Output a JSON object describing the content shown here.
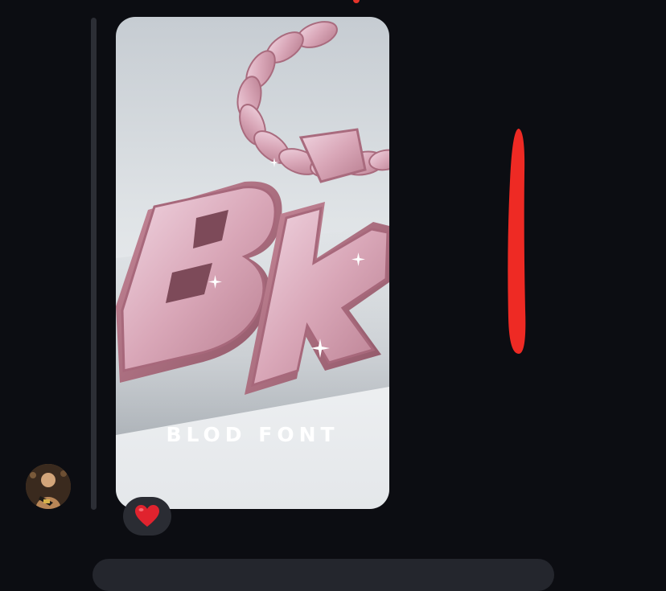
{
  "message": {
    "media": {
      "caption": "BLOD FONT",
      "subject": "pendant-image"
    },
    "reaction": {
      "emoji": "heart",
      "color": "#e0232e"
    }
  },
  "annotation": {
    "color": "#ee2a24"
  },
  "theme": {
    "background": "#0c0d12",
    "thread_line": "#2c2e35",
    "reaction_bg": "#2a2c33",
    "input_bg": "#24262d"
  }
}
